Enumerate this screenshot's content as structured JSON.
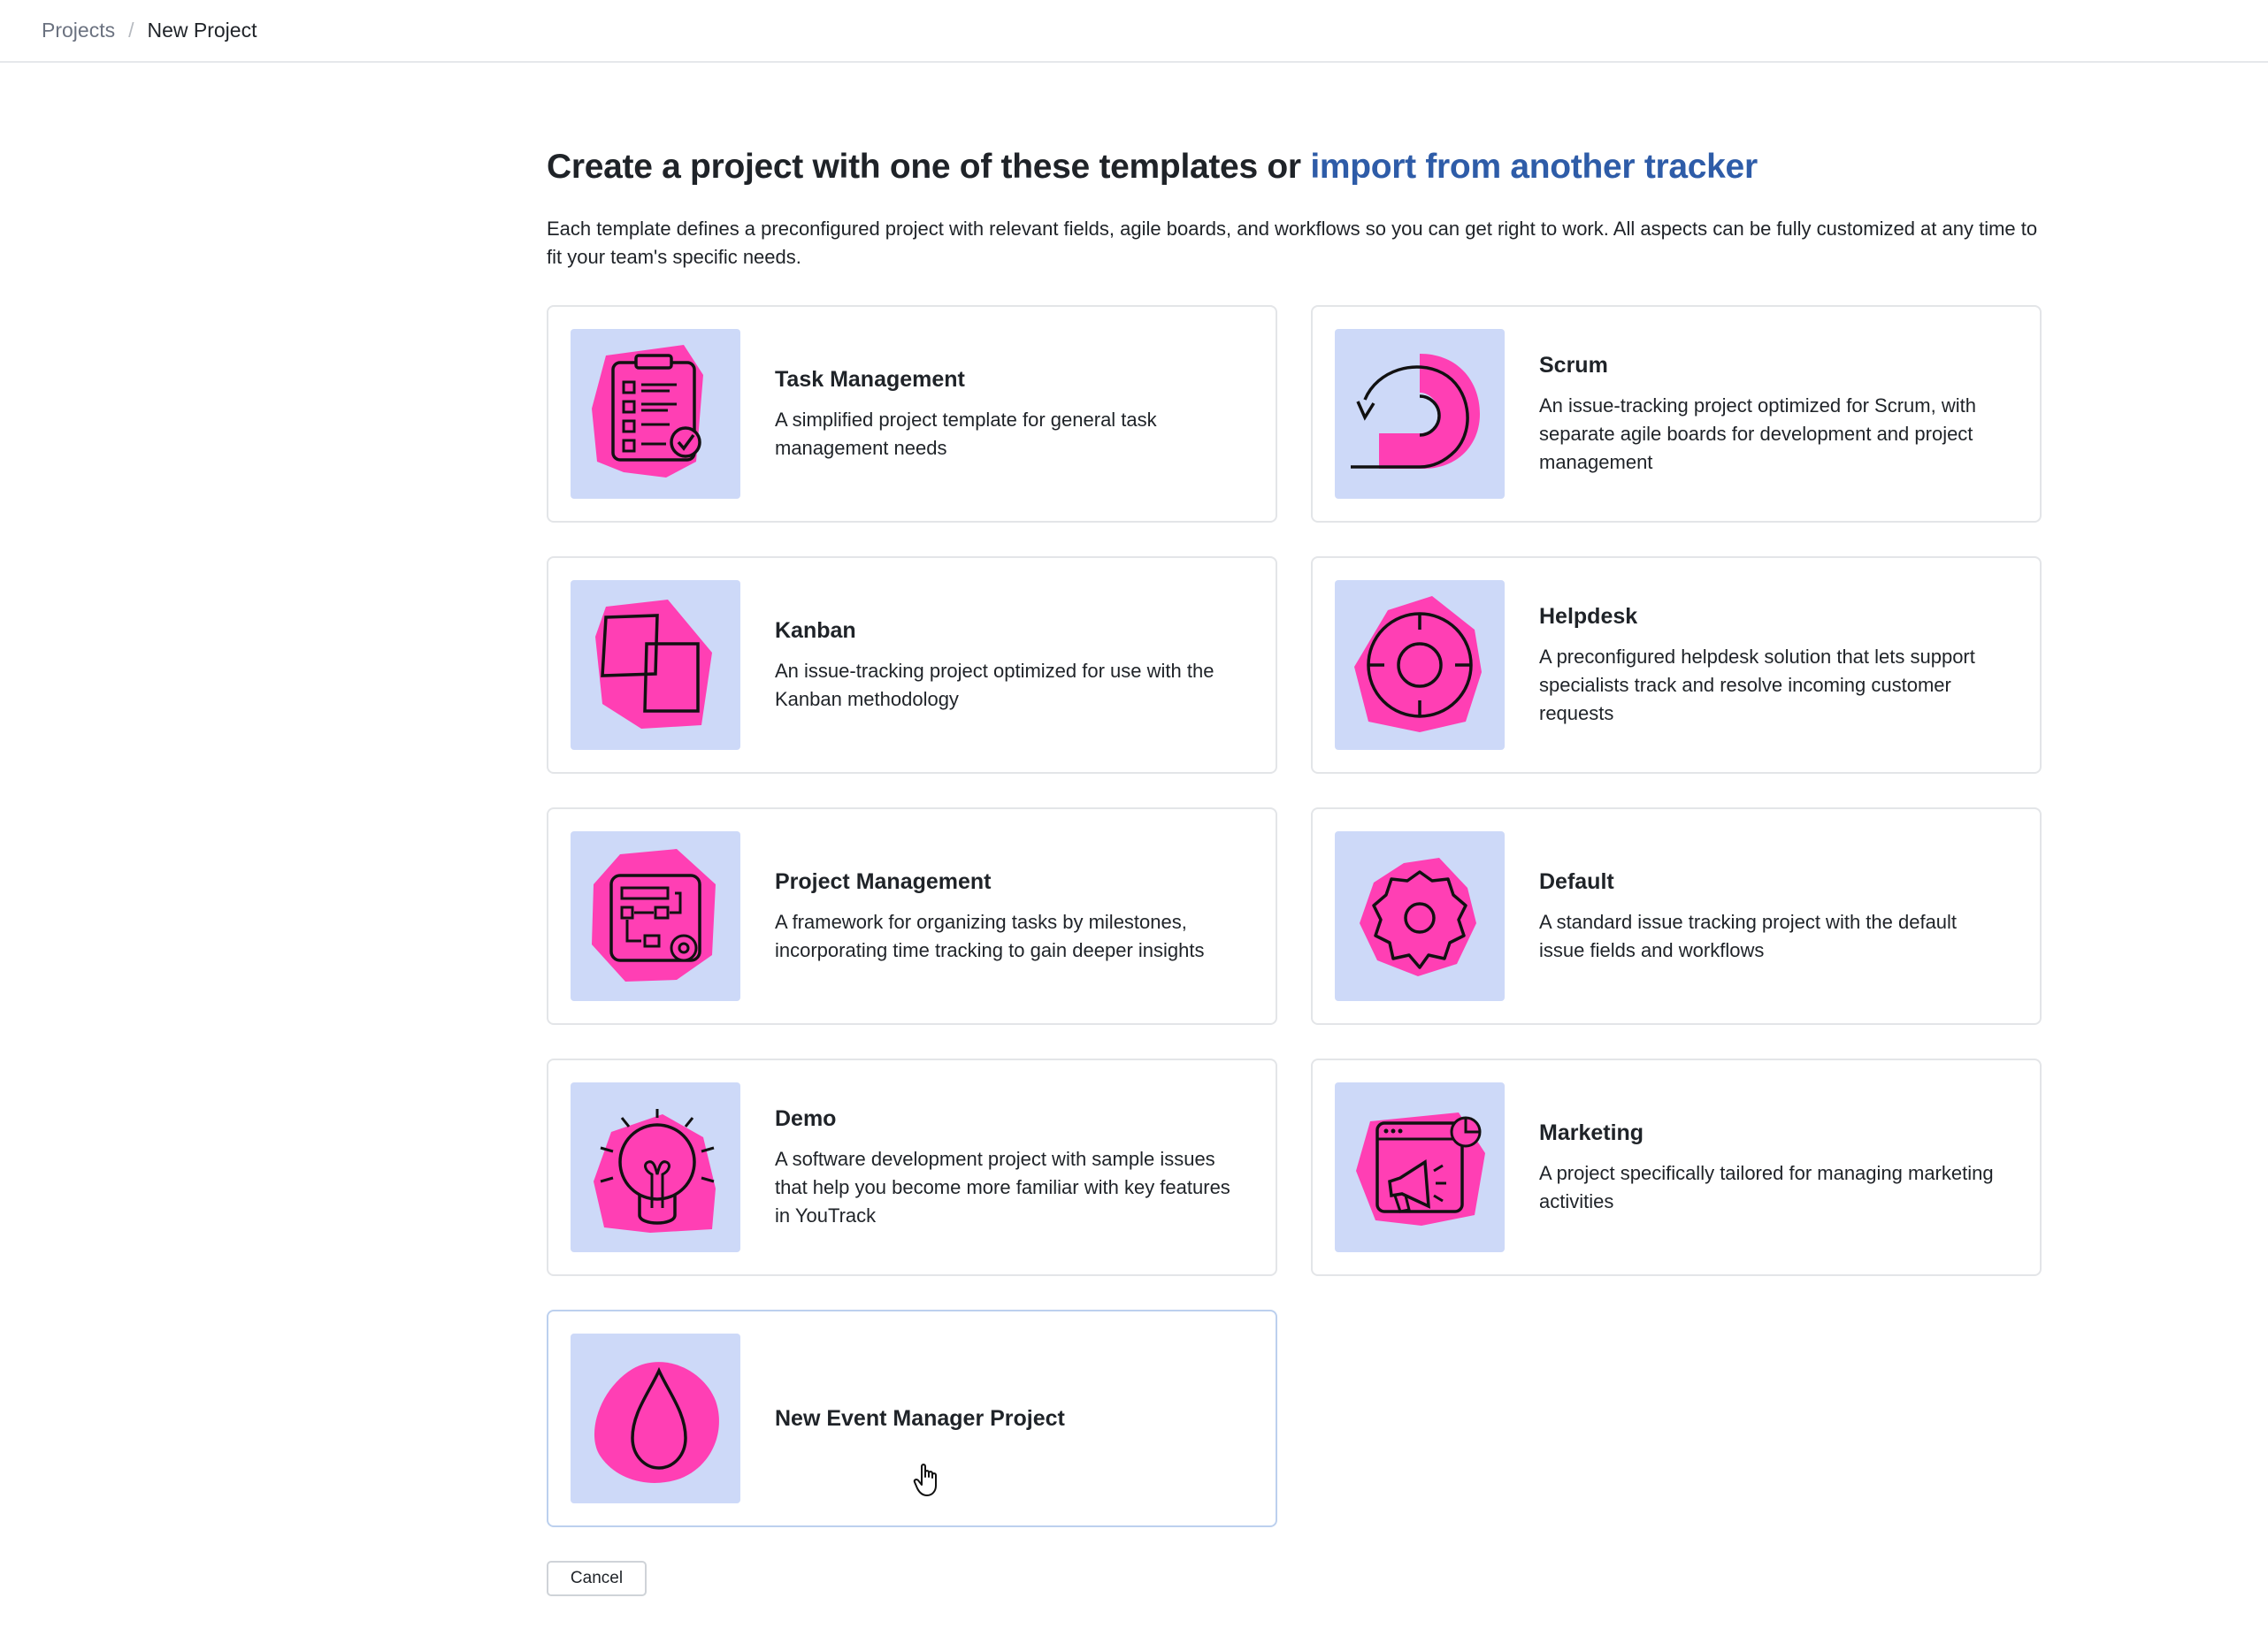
{
  "breadcrumb": {
    "parent": "Projects",
    "separator": "/",
    "current": "New Project"
  },
  "headline": {
    "text": "Create a project with one of these templates or ",
    "link": "import from another tracker"
  },
  "intro": "Each template defines a preconfigured project with relevant fields, agile boards, and workflows so you can get right to work. All aspects can be fully customized at any time to fit your team's specific needs.",
  "templates": [
    {
      "title": "Task Management",
      "desc": "A simplified project template for general task management needs",
      "icon": "clipboard-checklist-icon"
    },
    {
      "title": "Scrum",
      "desc": "An issue-tracking project optimized for Scrum, with separate agile boards for development and project management",
      "icon": "sprint-cycle-icon"
    },
    {
      "title": "Kanban",
      "desc": "An issue-tracking project optimized for use with the Kanban methodology",
      "icon": "overlapping-cards-icon"
    },
    {
      "title": "Helpdesk",
      "desc": "A preconfigured helpdesk solution that lets support specialists track and resolve incoming customer requests",
      "icon": "lifebuoy-icon"
    },
    {
      "title": "Project Management",
      "desc": "A framework for organizing tasks by milestones, incorporating time tracking to gain deeper insights",
      "icon": "workflow-board-icon"
    },
    {
      "title": "Default",
      "desc": "A standard issue tracking project with the default issue fields and workflows",
      "icon": "gear-icon"
    },
    {
      "title": "Demo",
      "desc": "A software development project with sample issues that help you become more familiar with key features in YouTrack",
      "icon": "lightbulb-icon"
    },
    {
      "title": "Marketing",
      "desc": "A project specifically tailored for managing marketing activities",
      "icon": "megaphone-window-icon"
    },
    {
      "title": "New Event Manager Project",
      "desc": "",
      "icon": "drop-icon"
    }
  ],
  "cancel_label": "Cancel",
  "colors": {
    "accent_link": "#2e5ca8",
    "thumb_bg": "#cdd9f8",
    "blob_pink": "#ff3fb4"
  }
}
